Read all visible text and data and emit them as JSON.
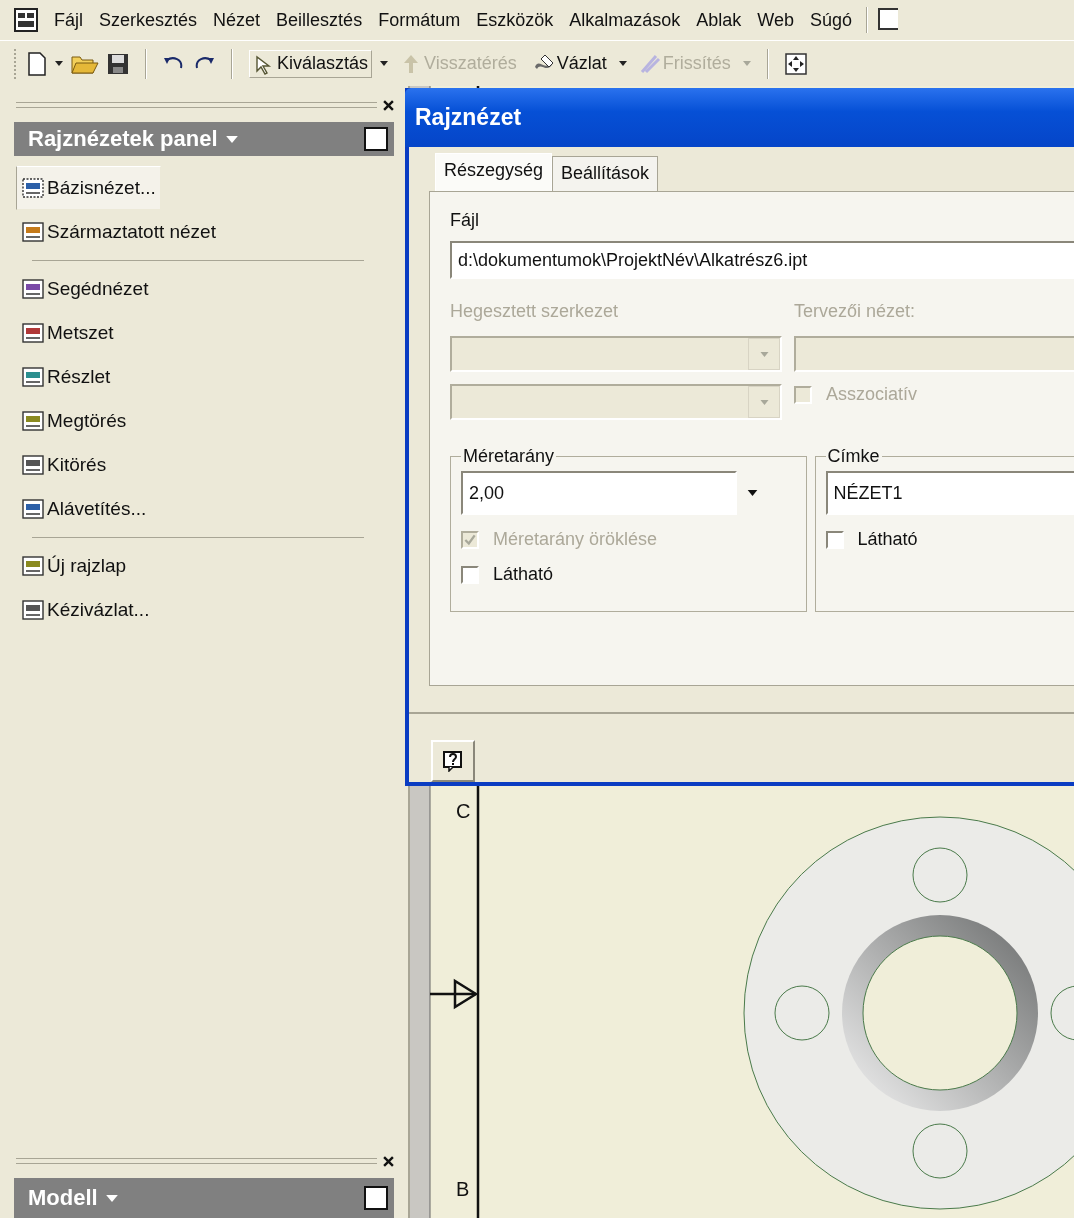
{
  "menu_bar": {
    "items": [
      "Fájl",
      "Szerkesztés",
      "Nézet",
      "Beillesztés",
      "Formátum",
      "Eszközök",
      "Alkalmazások",
      "Ablak",
      "Web",
      "Súgó"
    ]
  },
  "toolbar": {
    "buttons": [
      {
        "label": "Kiválasztás",
        "disabled": false,
        "dropdown": true
      },
      {
        "label": "Visszatérés",
        "disabled": true,
        "dropdown": false
      },
      {
        "label": "Vázlat",
        "disabled": false,
        "dropdown": true
      },
      {
        "label": "Frissítés",
        "disabled": true,
        "dropdown": true
      }
    ]
  },
  "panel": {
    "title": "Rajznézetek panel",
    "groups": [
      {
        "items": [
          {
            "label": "Bázisnézet...",
            "selected": true
          },
          {
            "label": "Származtatott nézet",
            "selected": false
          }
        ]
      },
      {
        "items": [
          {
            "label": "Segédnézet",
            "selected": false
          },
          {
            "label": "Metszet",
            "selected": false
          },
          {
            "label": "Részlet",
            "selected": false
          },
          {
            "label": "Megtörés",
            "selected": false
          },
          {
            "label": "Kitörés",
            "selected": false
          },
          {
            "label": "Alávetítés...",
            "selected": false
          }
        ]
      },
      {
        "items": [
          {
            "label": "Új rajzlap",
            "selected": false
          },
          {
            "label": "Kézivázlat...",
            "selected": false
          }
        ]
      }
    ]
  },
  "model_panel": {
    "title": "Modell"
  },
  "dialog": {
    "title": "Rajznézet",
    "tabs": [
      {
        "label": "Részegység",
        "selected": true
      },
      {
        "label": "Beállítások",
        "selected": false
      }
    ],
    "file": {
      "label": "Fájl",
      "value": "d:\\dokumentumok\\ProjektNév\\Alkatrész6.ipt"
    },
    "weldment": {
      "label": "Hegesztett szerkezet",
      "disabled": true
    },
    "design_view": {
      "label": "Tervezői nézet:",
      "disabled": true
    },
    "associative": {
      "label": "Asszociatív",
      "checked": false,
      "disabled": true
    },
    "scale": {
      "title": "Méretarány",
      "value": "2,00",
      "inherit": {
        "label": "Méretarány öröklése",
        "checked": true,
        "disabled": true
      },
      "visible": {
        "label": "Látható",
        "checked": false,
        "disabled": false
      }
    },
    "label": {
      "title": "Címke",
      "value": "NÉZET1",
      "visible": {
        "label": "Látható",
        "checked": false,
        "disabled": false
      }
    }
  },
  "drawing": {
    "zone_labels": [
      "C",
      "B"
    ]
  }
}
